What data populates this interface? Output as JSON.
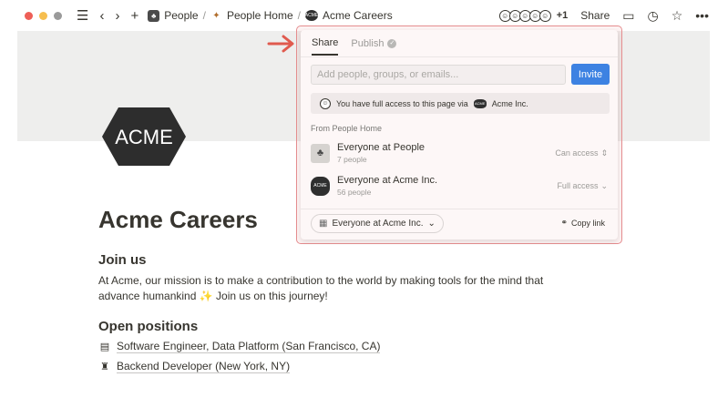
{
  "topbar": {
    "breadcrumbs": [
      "People",
      "People Home",
      "Acme Careers"
    ],
    "avatar_extra": "+1",
    "share_label": "Share"
  },
  "page": {
    "logo_text": "ACME",
    "title": "Acme Careers",
    "join_heading": "Join us",
    "paragraph": "At Acme, our mission is to make a contribution to the world by making tools for the mind that advance humankind ✨ Join us on this journey!",
    "open_heading": "Open positions",
    "jobs": [
      {
        "icon": "calendar-icon",
        "title": "Software Engineer, Data Platform (San Francisco, CA)"
      },
      {
        "icon": "statue-of-liberty-icon",
        "title": "Backend Developer (New York, NY)"
      }
    ]
  },
  "share_popup": {
    "tabs": [
      "Share",
      "Publish"
    ],
    "active_tab": "Share",
    "input_placeholder": "Add people, groups, or emails...",
    "invite_label": "Invite",
    "access_notice_prefix": "You have full access to this page via",
    "access_notice_org": "Acme Inc.",
    "section_label": "From People Home",
    "rows": [
      {
        "name": "Everyone at People",
        "sub": "7 people",
        "permission": "Can access"
      },
      {
        "name": "Everyone at Acme Inc.",
        "sub": "56 people",
        "permission": "Full access"
      }
    ],
    "scope_label": "Everyone at Acme Inc.",
    "copy_link_label": "Copy link"
  },
  "colors": {
    "accent": "#3d82e2",
    "highlight_border": "#e58d8f",
    "arrow": "#e05a4e"
  }
}
